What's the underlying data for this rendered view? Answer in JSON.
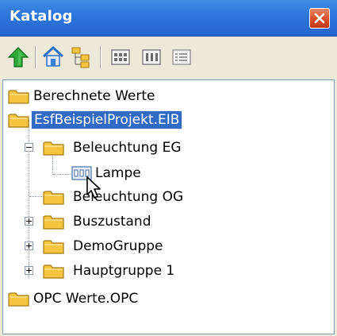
{
  "window": {
    "title": "Katalog",
    "close_icon": "close-icon"
  },
  "toolbar": {
    "buttons": [
      {
        "icon": "up-arrow-icon"
      },
      {
        "icon": "home-icon"
      },
      {
        "icon": "tree-structure-icon"
      },
      {
        "icon": "large-icons-view-icon"
      },
      {
        "icon": "small-icons-view-icon"
      },
      {
        "icon": "list-view-icon"
      }
    ]
  },
  "tree": {
    "items": [
      {
        "label": "Berechnete Werte",
        "icon": "folder-icon",
        "level": 0
      },
      {
        "label": "EsfBeispielProjekt.EIB",
        "icon": "folder-icon",
        "level": 0,
        "selected": true
      },
      {
        "label": "Beleuchtung EG",
        "icon": "folder-icon",
        "level": 1,
        "expander": "expanded"
      },
      {
        "label": "Lampe",
        "icon": "device-icon",
        "level": 2
      },
      {
        "label": "Beleuchtung OG",
        "icon": "folder-icon",
        "level": 1
      },
      {
        "label": "Buszustand",
        "icon": "folder-icon",
        "level": 1,
        "expander": "collapsed"
      },
      {
        "label": "DemoGruppe",
        "icon": "folder-icon",
        "level": 1,
        "expander": "collapsed"
      },
      {
        "label": "Hauptgruppe 1",
        "icon": "folder-icon",
        "level": 1,
        "expander": "collapsed"
      },
      {
        "label": "OPC Werte.OPC",
        "icon": "folder-icon",
        "level": 0
      }
    ]
  },
  "colors": {
    "titlebar": "#2f77dc",
    "selection": "#316ac5",
    "folder": "#f5c542"
  }
}
